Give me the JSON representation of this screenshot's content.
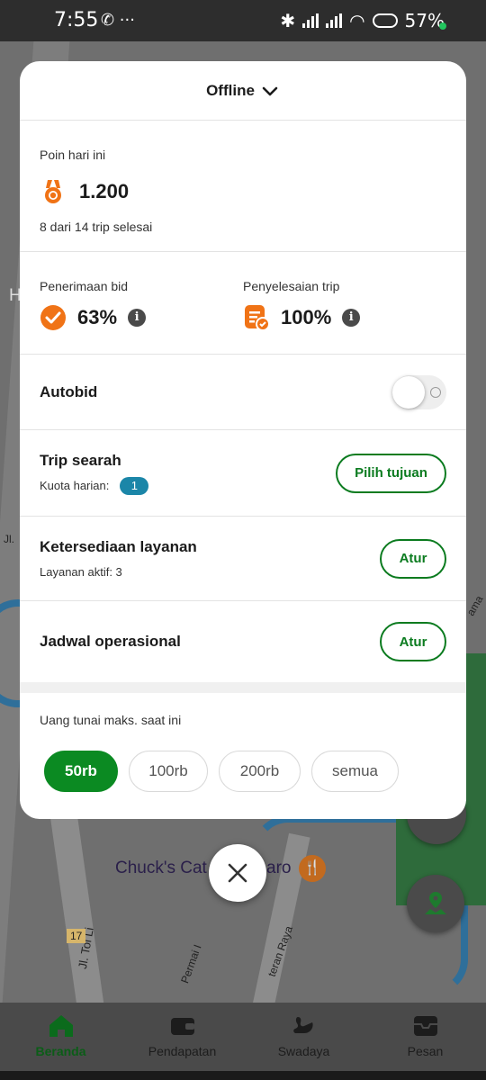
{
  "status_bar": {
    "time": "7:55",
    "battery": "57%"
  },
  "map": {
    "place_label": "Chuck's Cat",
    "place_label_tail": "aro",
    "road_label_1": "Jl. Tol Li",
    "road_label_2": "Permai I",
    "road_label_3": "teran Raya",
    "road_number": "17",
    "edge_label_h": "H",
    "edge_label_jl": "Jl.",
    "edge_label_ama": "ama"
  },
  "sheet": {
    "status_select": "Offline",
    "poin": {
      "label": "Poin hari ini",
      "value": "1.200",
      "subtitle": "8 dari 14 trip selesai"
    },
    "bid_acceptance": {
      "label": "Penerimaan bid",
      "value": "63%"
    },
    "trip_completion": {
      "label": "Penyelesaian trip",
      "value": "100%"
    },
    "autobid": {
      "label": "Autobid",
      "enabled": false
    },
    "trip_searah": {
      "title": "Trip searah",
      "quota_label": "Kuota harian:",
      "quota_value": "1",
      "button": "Pilih tujuan"
    },
    "ketersediaan": {
      "title": "Ketersediaan layanan",
      "subtitle": "Layanan aktif: 3",
      "button": "Atur"
    },
    "jadwal": {
      "title": "Jadwal operasional",
      "button": "Atur"
    },
    "cash": {
      "label": "Uang tunai maks. saat ini",
      "options": [
        "50rb",
        "100rb",
        "200rb",
        "semua"
      ],
      "selected": "50rb"
    }
  },
  "bottom_nav": {
    "items": [
      {
        "label": "Beranda",
        "icon": "home-icon",
        "active": true
      },
      {
        "label": "Pendapatan",
        "icon": "wallet-icon",
        "active": false
      },
      {
        "label": "Swadaya",
        "icon": "swan-icon",
        "active": false
      },
      {
        "label": "Pesan",
        "icon": "inbox-icon",
        "active": false
      }
    ]
  },
  "colors": {
    "brand_green": "#0b8a22",
    "badge_blue": "#1b86a8",
    "accent_orange": "#f07316"
  }
}
